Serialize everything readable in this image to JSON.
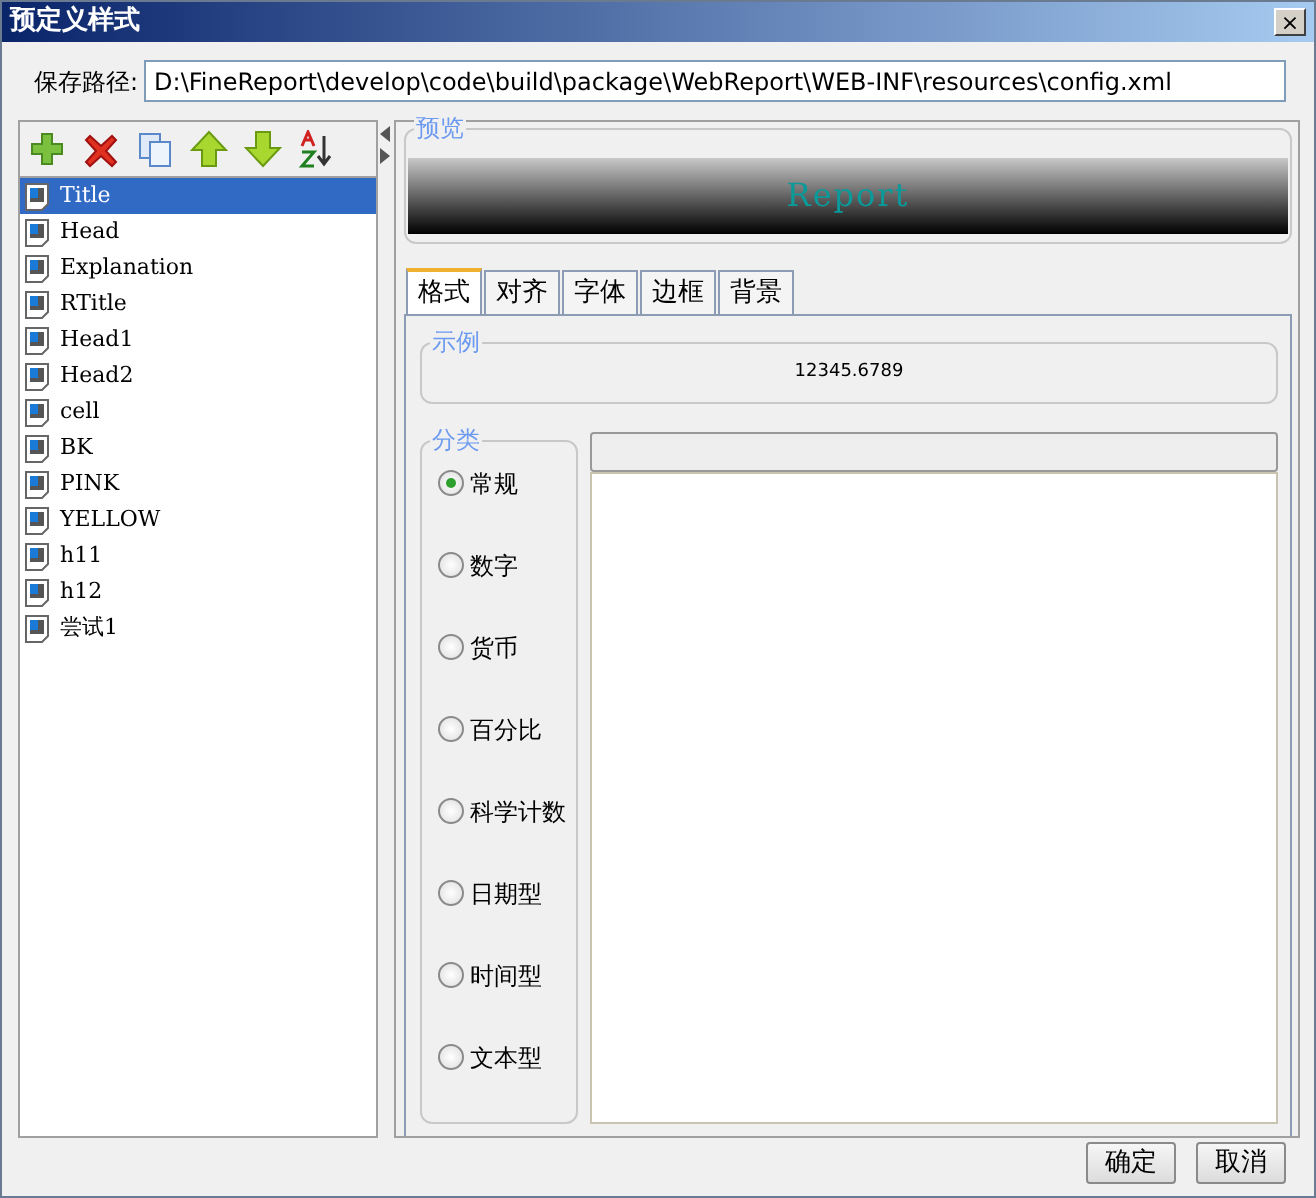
{
  "window": {
    "title": "预定义样式",
    "close": "×"
  },
  "save_path": {
    "label": "保存路径:",
    "value": "D:\\FineReport\\develop\\code\\build\\package\\WebReport\\WEB-INF\\resources\\config.xml"
  },
  "toolbar": [
    {
      "kind": "add"
    },
    {
      "kind": "delete"
    },
    {
      "kind": "copy"
    },
    {
      "kind": "up"
    },
    {
      "kind": "down"
    },
    {
      "kind": "sort"
    }
  ],
  "styles": [
    {
      "label": "Title",
      "selected": true
    },
    {
      "label": "Head",
      "selected": false
    },
    {
      "label": "Explanation",
      "selected": false
    },
    {
      "label": "RTitle",
      "selected": false
    },
    {
      "label": "Head1",
      "selected": false
    },
    {
      "label": "Head2",
      "selected": false
    },
    {
      "label": "cell",
      "selected": false
    },
    {
      "label": "BK",
      "selected": false
    },
    {
      "label": "PINK",
      "selected": false
    },
    {
      "label": "YELLOW",
      "selected": false
    },
    {
      "label": "h11",
      "selected": false
    },
    {
      "label": "h12",
      "selected": false
    },
    {
      "label": "尝试1",
      "selected": false
    }
  ],
  "preview": {
    "legend": "预览",
    "text": "Report"
  },
  "tabs": [
    {
      "label": "格式",
      "selected": true
    },
    {
      "label": "对齐",
      "selected": false
    },
    {
      "label": "字体",
      "selected": false
    },
    {
      "label": "边框",
      "selected": false
    },
    {
      "label": "背景",
      "selected": false
    }
  ],
  "sample": {
    "legend": "示例",
    "text": "12345.6789"
  },
  "category": {
    "legend": "分类",
    "options": [
      {
        "label": "常规",
        "selected": true
      },
      {
        "label": "数字",
        "selected": false
      },
      {
        "label": "货币",
        "selected": false
      },
      {
        "label": "百分比",
        "selected": false
      },
      {
        "label": "科学计数",
        "selected": false
      },
      {
        "label": "日期型",
        "selected": false
      },
      {
        "label": "时间型",
        "selected": false
      },
      {
        "label": "文本型",
        "selected": false
      }
    ]
  },
  "buttons": [
    {
      "label": "确定"
    },
    {
      "label": "取消"
    }
  ]
}
